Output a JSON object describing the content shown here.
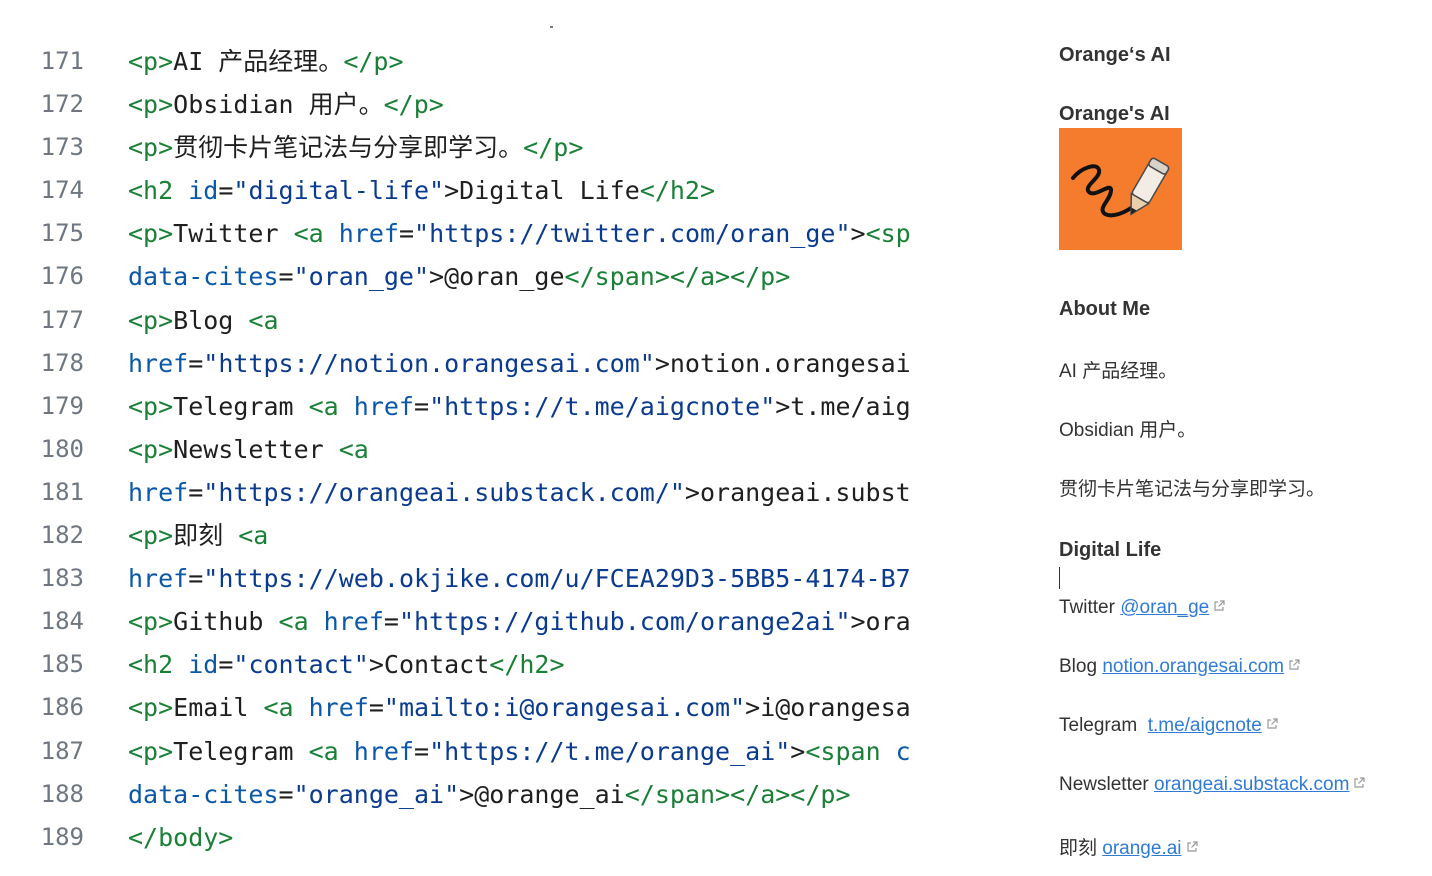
{
  "editor": {
    "lines": [
      {
        "num": "171",
        "tokens": [
          [
            "tag",
            "<p>"
          ],
          [
            "txt",
            "AI 产品经理。"
          ],
          [
            "tag",
            "</p>"
          ]
        ]
      },
      {
        "num": "172",
        "tokens": [
          [
            "tag",
            "<p>"
          ],
          [
            "txt",
            "Obsidian 用户。"
          ],
          [
            "tag",
            "</p>"
          ]
        ]
      },
      {
        "num": "173",
        "tokens": [
          [
            "tag",
            "<p>"
          ],
          [
            "txt",
            "贯彻卡片笔记法与分享即学习。"
          ],
          [
            "tag",
            "</p>"
          ]
        ]
      },
      {
        "num": "174",
        "tokens": [
          [
            "tag",
            "<h2 "
          ],
          [
            "attr",
            "id"
          ],
          [
            "txt",
            "="
          ],
          [
            "str",
            "\"digital-life\""
          ],
          [
            "txt",
            ">Digital Life"
          ],
          [
            "tag",
            "</h2>"
          ]
        ]
      },
      {
        "num": "175",
        "tokens": [
          [
            "tag",
            "<p>"
          ],
          [
            "txt",
            "Twitter "
          ],
          [
            "tag",
            "<a "
          ],
          [
            "attr",
            "href"
          ],
          [
            "txt",
            "="
          ],
          [
            "str",
            "\"https://twitter.com/oran_ge\""
          ],
          [
            "txt",
            ">"
          ],
          [
            "tag",
            "<sp"
          ]
        ]
      },
      {
        "num": "176",
        "tokens": [
          [
            "attr",
            "data-cites"
          ],
          [
            "txt",
            "="
          ],
          [
            "str",
            "\"oran_ge\""
          ],
          [
            "txt",
            ">@oran_ge"
          ],
          [
            "tag",
            "</span></a></p>"
          ]
        ]
      },
      {
        "num": "177",
        "tokens": [
          [
            "tag",
            "<p>"
          ],
          [
            "txt",
            "Blog "
          ],
          [
            "tag",
            "<a"
          ]
        ]
      },
      {
        "num": "178",
        "tokens": [
          [
            "attr",
            "href"
          ],
          [
            "txt",
            "="
          ],
          [
            "str",
            "\"https://notion.orangesai.com\""
          ],
          [
            "txt",
            ">notion.orangesai"
          ]
        ]
      },
      {
        "num": "179",
        "tokens": [
          [
            "tag",
            "<p>"
          ],
          [
            "txt",
            "Telegram "
          ],
          [
            "tag",
            "<a "
          ],
          [
            "attr",
            "href"
          ],
          [
            "txt",
            "="
          ],
          [
            "str",
            "\"https://t.me/aigcnote\""
          ],
          [
            "txt",
            ">t.me/aig"
          ]
        ]
      },
      {
        "num": "180",
        "tokens": [
          [
            "tag",
            "<p>"
          ],
          [
            "txt",
            "Newsletter "
          ],
          [
            "tag",
            "<a"
          ]
        ]
      },
      {
        "num": "181",
        "tokens": [
          [
            "attr",
            "href"
          ],
          [
            "txt",
            "="
          ],
          [
            "str",
            "\"https://orangeai.substack.com/\""
          ],
          [
            "txt",
            ">orangeai.subst"
          ]
        ]
      },
      {
        "num": "182",
        "tokens": [
          [
            "tag",
            "<p>"
          ],
          [
            "txt",
            "即刻 "
          ],
          [
            "tag",
            "<a"
          ]
        ]
      },
      {
        "num": "183",
        "tokens": [
          [
            "attr",
            "href"
          ],
          [
            "txt",
            "="
          ],
          [
            "str",
            "\"https://web.okjike.com/u/FCEA29D3-5BB5-4174-B7"
          ]
        ]
      },
      {
        "num": "184",
        "tokens": [
          [
            "tag",
            "<p>"
          ],
          [
            "txt",
            "Github "
          ],
          [
            "tag",
            "<a "
          ],
          [
            "attr",
            "href"
          ],
          [
            "txt",
            "="
          ],
          [
            "str",
            "\"https://github.com/orange2ai\""
          ],
          [
            "txt",
            ">ora"
          ]
        ]
      },
      {
        "num": "185",
        "tokens": [
          [
            "tag",
            "<h2 "
          ],
          [
            "attr",
            "id"
          ],
          [
            "txt",
            "="
          ],
          [
            "str",
            "\"contact\""
          ],
          [
            "txt",
            ">Contact"
          ],
          [
            "tag",
            "</h2>"
          ]
        ]
      },
      {
        "num": "186",
        "tokens": [
          [
            "tag",
            "<p>"
          ],
          [
            "txt",
            "Email "
          ],
          [
            "tag",
            "<a "
          ],
          [
            "attr",
            "href"
          ],
          [
            "txt",
            "="
          ],
          [
            "str",
            "\"mailto:i@orangesai.com\""
          ],
          [
            "txt",
            ">i@orangesa"
          ]
        ]
      },
      {
        "num": "187",
        "tokens": [
          [
            "tag",
            "<p>"
          ],
          [
            "txt",
            "Telegram "
          ],
          [
            "tag",
            "<a "
          ],
          [
            "attr",
            "href"
          ],
          [
            "txt",
            "="
          ],
          [
            "str",
            "\"https://t.me/orange_ai\""
          ],
          [
            "txt",
            ">"
          ],
          [
            "tag",
            "<span "
          ],
          [
            "attr",
            "c"
          ]
        ]
      },
      {
        "num": "188",
        "tokens": [
          [
            "attr",
            "data-cites"
          ],
          [
            "txt",
            "="
          ],
          [
            "str",
            "\"orange_ai\""
          ],
          [
            "txt",
            ">@orange_ai"
          ],
          [
            "tag",
            "</span></a></p>"
          ]
        ]
      },
      {
        "num": "189",
        "tokens": [
          [
            "tag",
            "</body>"
          ]
        ]
      }
    ]
  },
  "preview": {
    "site_title": "Orange‘s AI",
    "avatar_title": "Orange's AI",
    "about_heading": "About Me",
    "about_lines": [
      "AI 产品经理。",
      "Obsidian 用户。",
      "贯彻卡片笔记法与分享即学习。"
    ],
    "digital_life_heading": "Digital Life",
    "links": [
      {
        "label": "Twitter ",
        "link": "@oran_ge"
      },
      {
        "label": "Blog ",
        "link": "notion.orangesai.com"
      },
      {
        "label": "Telegram  ",
        "link": "t.me/aigcnote"
      },
      {
        "label": "Newsletter ",
        "link": "orangeai.substack.com"
      },
      {
        "label": "即刻 ",
        "link": "orange.ai"
      }
    ]
  },
  "colors": {
    "tag": "#1a7f37",
    "attr": "#0b58a8",
    "string": "#0a3b8f",
    "link": "#2f7bd6",
    "avatar_bg": "#f47c2c"
  },
  "icons": [
    "external-link-icon",
    "pencil-scribble-icon"
  ]
}
